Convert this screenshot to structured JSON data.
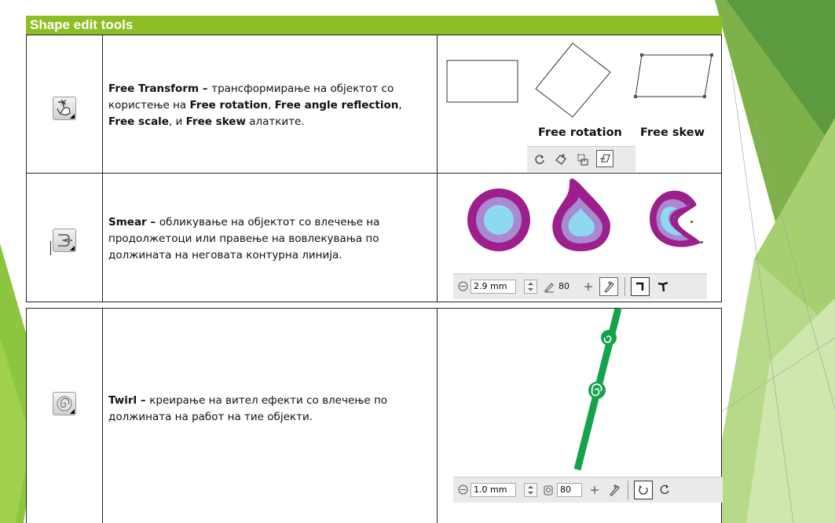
{
  "header": {
    "title": "Shape edit tools"
  },
  "rows": [
    {
      "tool": "Free Transform",
      "dash": " – ",
      "text_a": "трансформирање на објектот со користење на ",
      "b1": "Free rotation",
      "sep1": ", ",
      "b2": "Free angle reflection",
      "sep2": ", ",
      "b3": "Free scale",
      "sep3": ", и ",
      "b4": "Free skew",
      "text_b": " алатките.",
      "label_rotation": "Free rotation",
      "label_skew": "Free skew",
      "icon": "free-transform-icon"
    },
    {
      "tool": "Smear",
      "dash": " – ",
      "text_a": "обликување на објектот со влечење на продолжетоци или правење на вовлекувања по должината на неговата контурна линија.",
      "nib_value": "2.9 mm",
      "pressure_value": "80",
      "icon": "smear-icon",
      "colors": {
        "outer": "#9c1f8c",
        "mid": "#a98ad0",
        "inner": "#8fd8f2"
      }
    },
    {
      "tool": "Twirl",
      "dash": " – ",
      "text_a": "креирање на вител ефекти со влечење по должината на работ на тие објекти.",
      "radius_value": "1.0 mm",
      "speed_value": "80",
      "icon": "twirl-icon",
      "colors": {
        "line": "#14a24b"
      }
    }
  ],
  "colors": {
    "header_bg": "#8cbf25",
    "deco_green": "#7bb238"
  }
}
